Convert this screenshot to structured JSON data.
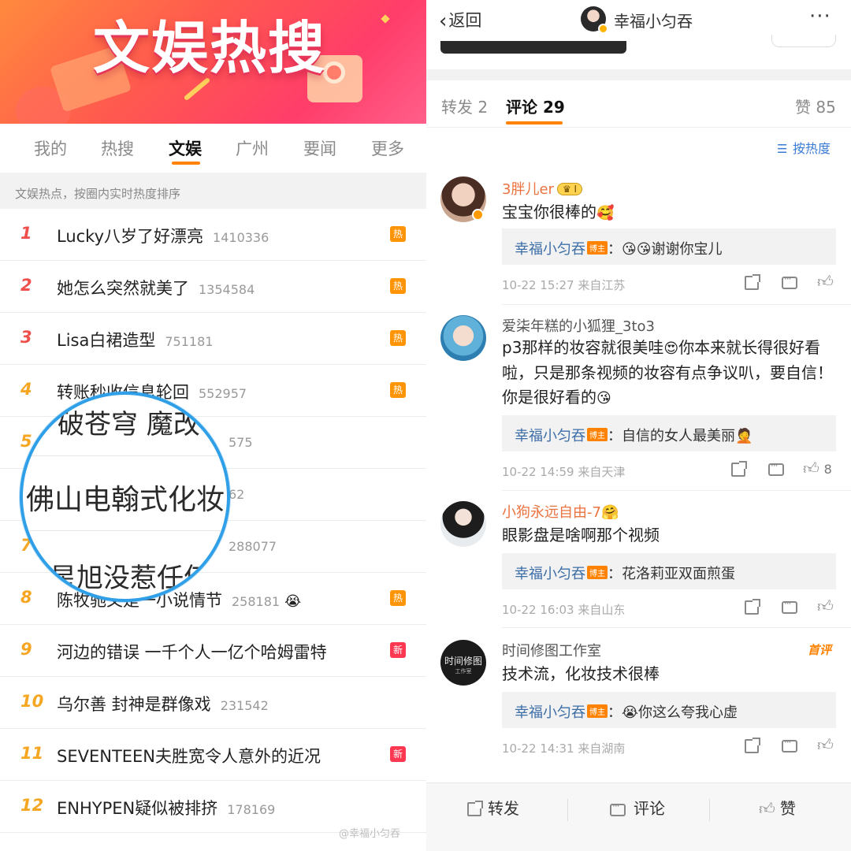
{
  "left": {
    "banner_title": "文娱热搜",
    "tabs": [
      "我的",
      "热搜",
      "文娱",
      "广州",
      "要闻",
      "更多"
    ],
    "active_tab": "文娱",
    "subhead": "文娱热点，按圈内实时热度排序",
    "hot_list": [
      {
        "rank": "1",
        "title": "Lucky八岁了好漂亮",
        "count": "1410336",
        "badge": "热",
        "color": "#f0504c"
      },
      {
        "rank": "2",
        "title": "她怎么突然就美了",
        "count": "1354584",
        "badge": "热",
        "color": "#f0504c"
      },
      {
        "rank": "3",
        "title": "Lisa白裙造型",
        "count": "751181",
        "badge": "热",
        "color": "#f0504c"
      },
      {
        "rank": "4",
        "title": "转账秒收信息轮回",
        "count": "552957",
        "badge": "热",
        "color": "#f5a623"
      },
      {
        "rank": "5",
        "title": "",
        "count": "575",
        "badge": "",
        "color": "#f5a623"
      },
      {
        "rank": "",
        "title": "",
        "count": "62",
        "badge": "",
        "color": "#f5a623"
      },
      {
        "rank": "7",
        "title": "",
        "count": "288077",
        "badge": "",
        "color": "#f5a623"
      },
      {
        "rank": "8",
        "title": "陈牧驰又是一小说情节",
        "count": "258181",
        "emoji": "😭",
        "badge": "热",
        "color": "#f5a623"
      },
      {
        "rank": "9",
        "title": "河边的错误 一千个人一亿个哈姆雷特",
        "count": "",
        "badge": "新",
        "color": "#f5a623"
      },
      {
        "rank": "10",
        "title": "乌尔善 封神是群像戏",
        "count": "231542",
        "badge": "",
        "color": "#f5a623"
      },
      {
        "rank": "11",
        "title": "SEVENTEEN夫胜宽令人意外的近况",
        "count": "",
        "badge": "新",
        "color": "#f5a623"
      },
      {
        "rank": "12",
        "title": "ENHYPEN疑似被排挤",
        "count": "178169",
        "badge": "",
        "color": "#f5a623"
      }
    ],
    "magnifier_lines": [
      "破苍穹 魔改",
      "佛山电翰式化妆",
      "星旭没惹任何"
    ],
    "watermark": "@幸福小匀吞"
  },
  "right": {
    "back_label": "返回",
    "user_name": "幸福小匀吞",
    "more_label": "···",
    "tabs": {
      "repost": "转发 2",
      "comment": "评论 29",
      "like": "赞 85"
    },
    "sort_label": "按热度",
    "comments": [
      {
        "name": "3胖儿er",
        "badge": "I",
        "text": "宝宝你很棒的",
        "text_emoji": "🥰",
        "reply_name": "幸福小匀吞",
        "reply_tag": "博主",
        "reply_text": "谢谢你宝儿",
        "reply_emoji": "😘😘",
        "meta": "10-22 15:27 来自江苏",
        "likes": ""
      },
      {
        "name": "爱柒年糕的小狐狸_3to3",
        "text": "p3那样的妆容就很美哇",
        "text_emoji": "😍",
        "text2": "你本来就长得很好看啦，只是那条视频的妆容有点争议叭，要自信！你是很好看的",
        "text2_emoji": "😘",
        "reply_name": "幸福小匀吞",
        "reply_tag": "博主",
        "reply_text": "自信的女人最美丽",
        "reply_emoji": "🤦",
        "meta": "10-22 14:59 来自天津",
        "likes": "8"
      },
      {
        "name": "小狗永远自由-7",
        "name_emoji": "🤗",
        "text": "眼影盘是啥啊那个视频",
        "reply_name": "幸福小匀吞",
        "reply_tag": "博主",
        "reply_text": "花洛莉亚双面煎蛋",
        "meta": "10-22 16:03 来自山东",
        "likes": ""
      },
      {
        "name": "时间修图工作室",
        "avatar_text": "时间修图",
        "avatar_sub": "工作室",
        "first_tag": "首评",
        "text": "技术流，化妆技术很棒",
        "reply_name": "幸福小匀吞",
        "reply_tag": "博主",
        "reply_text": "你这么夸我心虚",
        "reply_emoji": "😭",
        "meta": "10-22 14:31 来自湖南",
        "likes": ""
      }
    ],
    "bottom_bar": {
      "repost": "转发",
      "comment": "评论",
      "like": "赞"
    }
  },
  "colors": {
    "accent": "#ff8200",
    "hot_badge": "#ff9406",
    "new_badge": "#ff3852",
    "link_blue": "#3d6ea8",
    "username_orange": "#eb7340"
  }
}
